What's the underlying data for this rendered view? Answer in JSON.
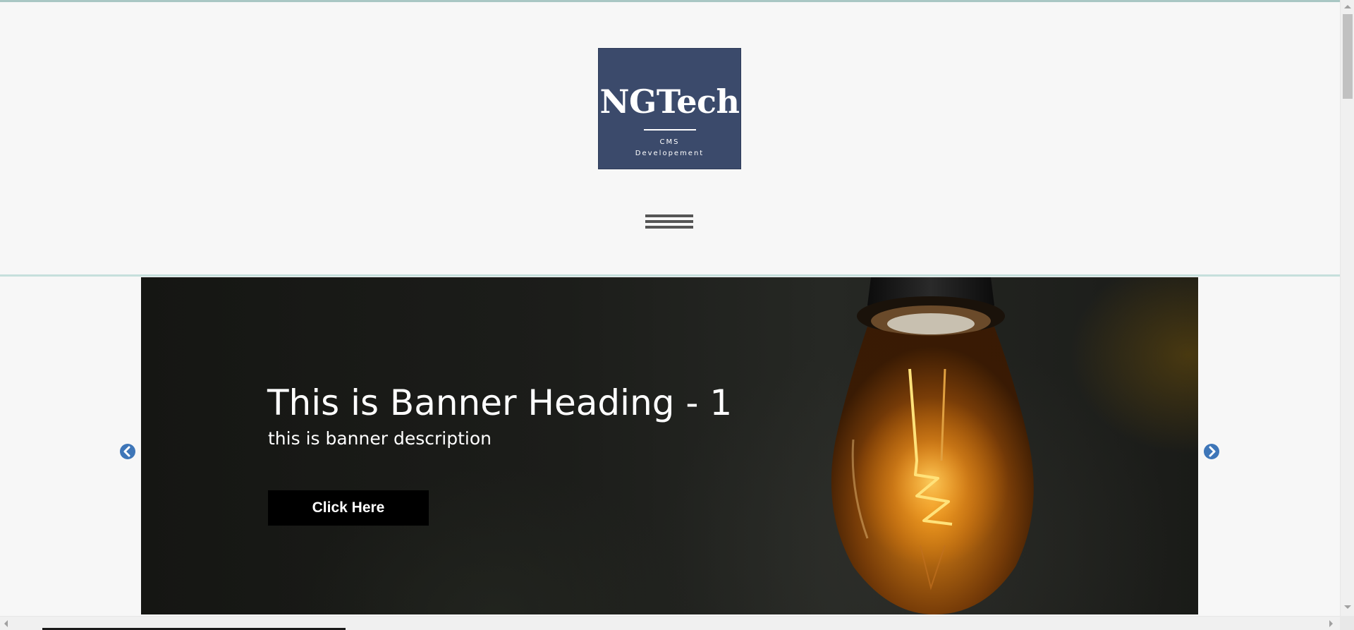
{
  "header": {
    "logo": {
      "title": "NGTech",
      "subtitle_line1": "CMS",
      "subtitle_line2": "Developement",
      "background_color": "#3b4a6b"
    },
    "menu_icon": "hamburger-menu-icon"
  },
  "banner": {
    "heading": "This is Banner Heading - 1",
    "description": "this is banner description",
    "button_label": "Click Here",
    "image_subject": "glowing light bulb",
    "prev_icon": "chevron-left-circle-icon",
    "next_icon": "chevron-right-circle-icon",
    "arrow_color": "#3e76b8"
  },
  "colors": {
    "page_background": "#f7f7f7",
    "header_border": "#c6dfdc",
    "button_background": "#000000"
  }
}
